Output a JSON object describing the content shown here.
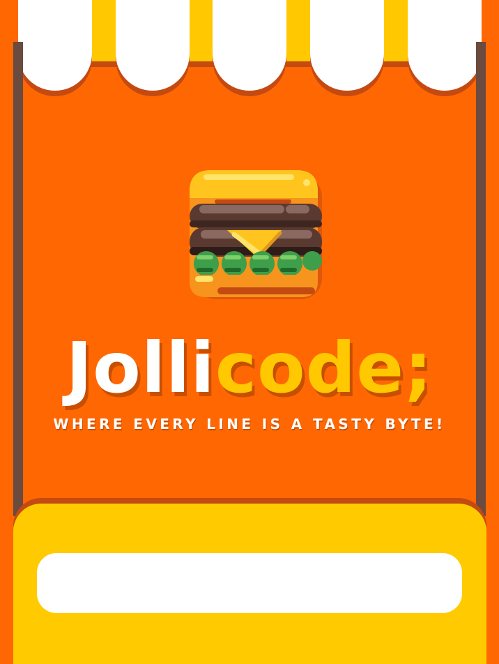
{
  "brand": {
    "title_part_a": "Jolli",
    "title_part_b": "code;",
    "tagline": "WHERE EVERY LINE IS A TASTY BYTE!"
  },
  "logo": {
    "icon": "burger-icon"
  },
  "colors": {
    "background": "#ff6703",
    "awning_stripe": "#ffc800",
    "awning_scallop": "#ffffff",
    "accent_yellow": "#ffc800",
    "counter": "#ffcb00",
    "post": "#6b4a3f"
  },
  "counter": {
    "slot_text": ""
  }
}
